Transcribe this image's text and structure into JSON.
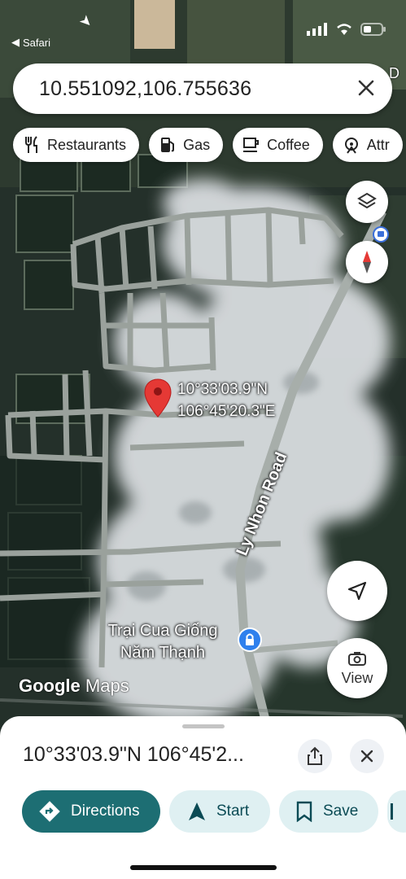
{
  "status_bar": {
    "back_app": "Safari"
  },
  "search": {
    "value": "10.551092,106.755636"
  },
  "chips": [
    {
      "label": "Restaurants",
      "icon": "fork-knife-icon"
    },
    {
      "label": "Gas",
      "icon": "gas-pump-icon"
    },
    {
      "label": "Coffee",
      "icon": "coffee-cup-icon"
    },
    {
      "label": "Attr",
      "icon": "attractions-icon"
    }
  ],
  "map": {
    "pin_coords_line1": "10°33'03.9\"N",
    "pin_coords_line2": "106°45'20.3\"E",
    "road_name": "Ly Nhon Road",
    "poi_name_line1": "Trại Cua Giống",
    "poi_name_line2": "Năm Thạnh",
    "logo_google": "Google",
    "logo_maps": "Maps",
    "top_right_fragment": "D",
    "view_label": "View"
  },
  "sheet": {
    "title": "10°33'03.9\"N 106°45'2...",
    "actions": [
      {
        "label": "Directions"
      },
      {
        "label": "Start"
      },
      {
        "label": "Save"
      }
    ]
  },
  "colors": {
    "accent": "#1d6e73",
    "pin_red": "#e53935",
    "chip_bg": "#ffffff",
    "action_tint": "#dff0f2"
  }
}
